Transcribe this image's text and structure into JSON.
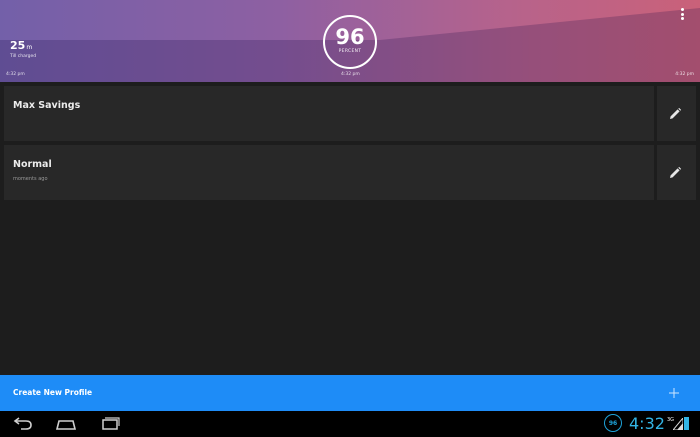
{
  "header": {
    "remaining_value": "25",
    "remaining_unit": "m",
    "remaining_caption": "Till charged",
    "percent_value": "96",
    "percent_label": "PERCENT",
    "time_left": "4:32 pm",
    "time_mid": "4:32 pm",
    "time_right": "4:32 pm",
    "colors": {
      "gradient_start": "#6e5aa6",
      "gradient_end": "#c85b74"
    }
  },
  "profiles": [
    {
      "name": "Max Savings",
      "meta": ""
    },
    {
      "name": "Normal",
      "meta": "moments ago"
    }
  ],
  "create_bar": {
    "label": "Create New Profile",
    "color": "#1e8cf7"
  },
  "status_bar": {
    "app_badge": "96",
    "clock": "4:32",
    "network": "3G",
    "accent": "#33b5e5"
  }
}
